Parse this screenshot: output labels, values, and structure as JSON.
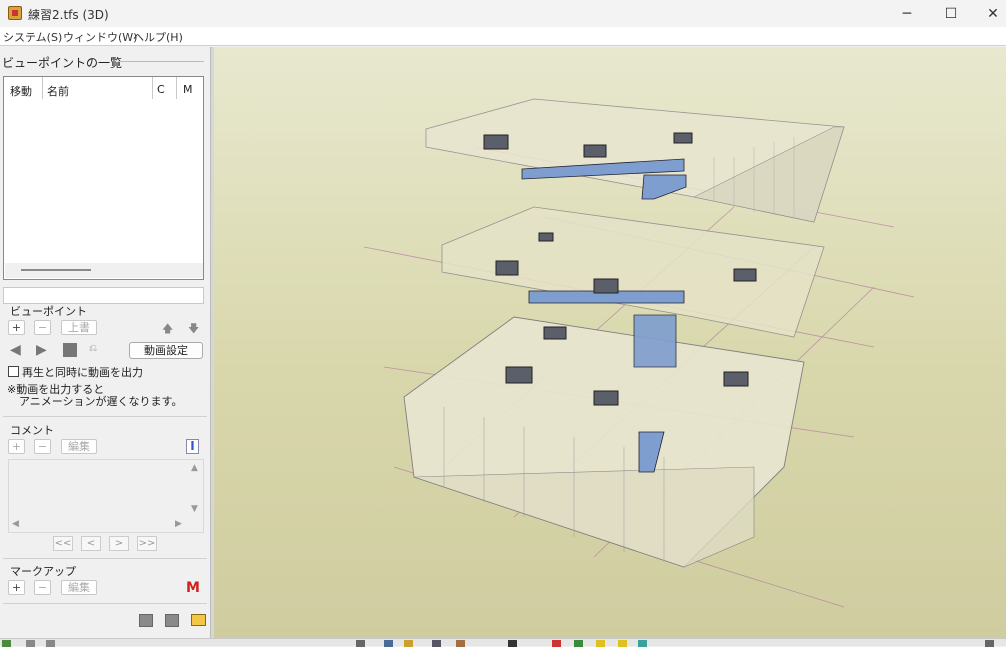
{
  "window": {
    "title": "練習2.tfs (3D)",
    "minimize": "─",
    "maximize": "☐",
    "close": "✕"
  },
  "menu": [
    "システム(S)",
    "ウィンドウ(W)",
    "ヘルプ(H)"
  ],
  "viewpoints_panel": {
    "header": "ビューポイントの一覧",
    "columns": [
      "移動",
      "名前",
      "C",
      "M"
    ],
    "section_label": "ビューポイント",
    "add": "+",
    "remove": "−",
    "overwrite": "上書",
    "up_arrow": "🡅",
    "down_arrow": "🡇",
    "anim_settings": "動画設定",
    "export_checkbox_label": "再生と同時に動画を出力",
    "note_line1": "※動画を出力すると",
    "note_line2": "アニメーションが遅くなります。"
  },
  "comment_panel": {
    "header": "コメント",
    "add": "+",
    "remove": "−",
    "edit": "編集",
    "cursor": "I",
    "nav": [
      "<<",
      "<",
      ">",
      ">>"
    ]
  },
  "markup_panel": {
    "header": "マークアップ",
    "add": "+",
    "remove": "−",
    "edit": "編集",
    "m_icon": "M"
  },
  "icons": [
    "app-icon",
    "play-icon",
    "rewind-icon",
    "stop-icon",
    "record-icon",
    "folder-open-icon"
  ],
  "colors": {
    "duct": "#7e9ecf",
    "viewport_bg": "#d8d7ab",
    "grid_line": "#b07a9a",
    "m_icon": "#d02020"
  }
}
